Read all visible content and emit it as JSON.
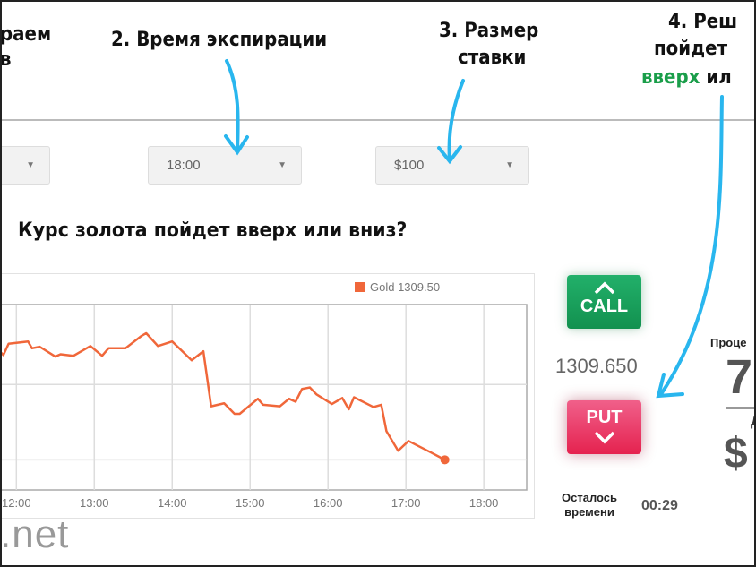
{
  "annotations": {
    "step1_line1": "раем",
    "step1_line2": "в",
    "step2": "2. Время экспирации",
    "step3_line1": "3. Размер",
    "step3_line2": "ставки",
    "step4_line1": "4. Реш",
    "step4_line2": "пойдет",
    "step4_line3_green": "вверх",
    "step4_line3_rest": " ил"
  },
  "controls": {
    "asset_dropdown": "",
    "expiry_dropdown": "18:00",
    "amount_dropdown": "$100"
  },
  "heading": "Курс золота пойдет вверх или вниз?",
  "chart_data": {
    "type": "line",
    "title": "",
    "xlabel": "",
    "ylabel": "",
    "x_ticks": [
      "12:00",
      "13:00",
      "14:00",
      "15:00",
      "16:00",
      "17:00",
      "18:00"
    ],
    "xlim": [
      "11:46",
      "18:33"
    ],
    "y_note_unlabeled": true,
    "ylim": [
      -0.4,
      2.06
    ],
    "y_gridlines": [
      0,
      1
    ],
    "grid": true,
    "legend_position": "top-right",
    "series": [
      {
        "name": "Gold 1309.50",
        "color": "#f0673a",
        "x": [
          "11:46",
          "11:50",
          "11:54",
          "12:09",
          "12:12",
          "12:18",
          "12:30",
          "12:34",
          "12:44",
          "12:57",
          "13:06",
          "13:11",
          "13:24",
          "13:36",
          "13:40",
          "13:49",
          "14:00",
          "14:15",
          "14:24",
          "14:30",
          "14:40",
          "14:48",
          "14:52",
          "15:06",
          "15:10",
          "15:23",
          "15:30",
          "15:35",
          "15:40",
          "15:46",
          "15:51",
          "16:03",
          "16:11",
          "16:16",
          "16:20",
          "16:35",
          "16:41",
          "16:45",
          "16:54",
          "17:02",
          "17:19",
          "17:30"
        ],
        "y": [
          1.46,
          1.39,
          1.54,
          1.57,
          1.48,
          1.5,
          1.37,
          1.4,
          1.38,
          1.51,
          1.38,
          1.48,
          1.48,
          1.64,
          1.68,
          1.51,
          1.57,
          1.32,
          1.44,
          0.71,
          0.75,
          0.61,
          0.61,
          0.81,
          0.73,
          0.71,
          0.81,
          0.77,
          0.94,
          0.96,
          0.87,
          0.74,
          0.82,
          0.67,
          0.83,
          0.7,
          0.73,
          0.38,
          0.12,
          0.25,
          0.1,
          0
        ]
      }
    ]
  },
  "trade": {
    "call_label": "CALL",
    "put_label": "PUT",
    "current_price": "1309.650",
    "remaining_line1": "Осталось",
    "remaining_line2": "времени",
    "timer": "00:29"
  },
  "payout": {
    "label": "Проце",
    "percent_partial": "7",
    "small_letter": "Д",
    "amount_partial": "$"
  },
  "watermark": ".net",
  "colors": {
    "accent_arrow": "#29b6ee",
    "call": "#16a05a",
    "put": "#e8315a",
    "line": "#f0673a",
    "green_text": "#1a9e4a"
  }
}
